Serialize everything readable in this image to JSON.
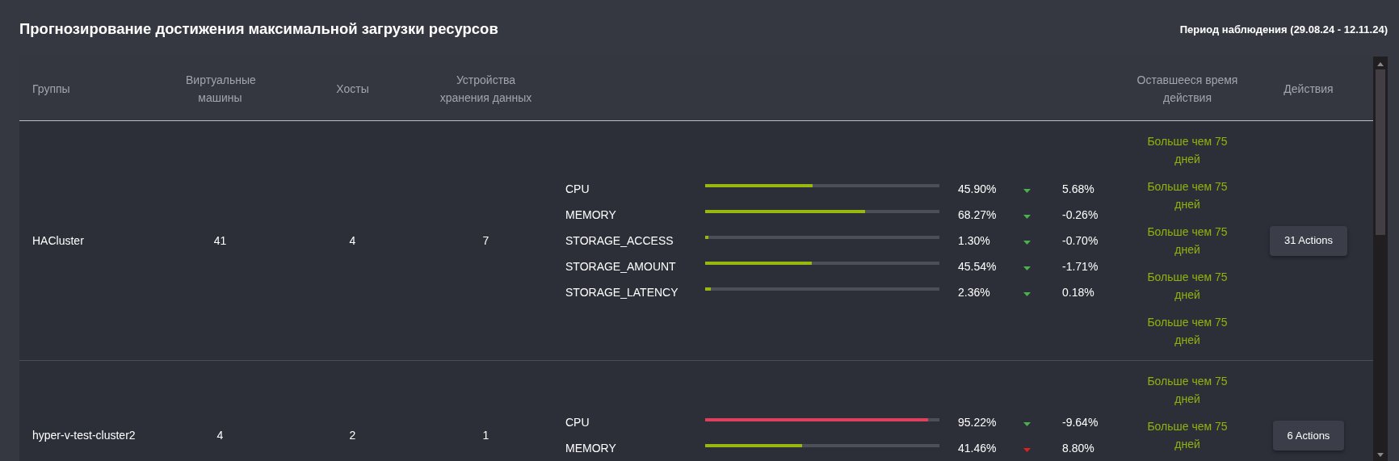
{
  "title": "Прогнозирование достижения максимальной загрузки ресурсов",
  "period": "Период наблюдения (29.08.24 - 12.11.24)",
  "table": {
    "columns": [
      "Группы",
      "Виртуальные машины",
      "Хосты",
      "Устройства хранения данных",
      "Оставшееся время действия",
      "Действия"
    ],
    "rows": [
      {
        "group": "HACluster",
        "vms": "41",
        "hosts": "4",
        "storage": "7",
        "metrics": [
          {
            "name": "CPU",
            "level": 0.459,
            "color": "#97b80f",
            "value": "45.90%",
            "trend": {
              "color": "#4caf50"
            },
            "delta": "5.68%"
          },
          {
            "name": "MEMORY",
            "level": 0.6827,
            "color": "#97b80f",
            "value": "68.27%",
            "trend": {
              "color": "#4caf50"
            },
            "delta": "-0.26%"
          },
          {
            "name": "STORAGE_ACCESS",
            "level": 0.013,
            "color": "#97b80f",
            "value": "1.30%",
            "trend": {
              "color": "#4caf50"
            },
            "delta": "-0.70%"
          },
          {
            "name": "STORAGE_AMOUNT",
            "level": 0.4554,
            "color": "#97b80f",
            "value": "45.54%",
            "trend": {
              "color": "#4caf50"
            },
            "delta": "-1.71%"
          },
          {
            "name": "STORAGE_LATENCY",
            "level": 0.0236,
            "color": "#97b80f",
            "value": "2.36%",
            "trend": {
              "color": "#4caf50"
            },
            "delta": "0.18%"
          }
        ],
        "remaining": [
          "Больше чем 75 дней",
          "Больше чем 75 дней",
          "Больше чем 75 дней",
          "Больше чем 75 дней",
          "Больше чем 75 дней"
        ],
        "action": "31 Actions"
      },
      {
        "group": "hyper-v-test-cluster2",
        "vms": "4",
        "hosts": "2",
        "storage": "1",
        "metrics": [
          {
            "name": "CPU",
            "level": 0.9522,
            "color": "#e0405e",
            "value": "95.22%",
            "trend": {
              "color": "#4caf50"
            },
            "delta": "-9.64%"
          },
          {
            "name": "MEMORY",
            "level": 0.4146,
            "color": "#97b80f",
            "value": "41.46%",
            "trend": {
              "color": "#e02020"
            },
            "delta": "8.80%"
          }
        ],
        "remaining": [
          "Больше чем 75 дней",
          "Больше чем 75 дней"
        ],
        "action": "6 Actions"
      }
    ]
  }
}
